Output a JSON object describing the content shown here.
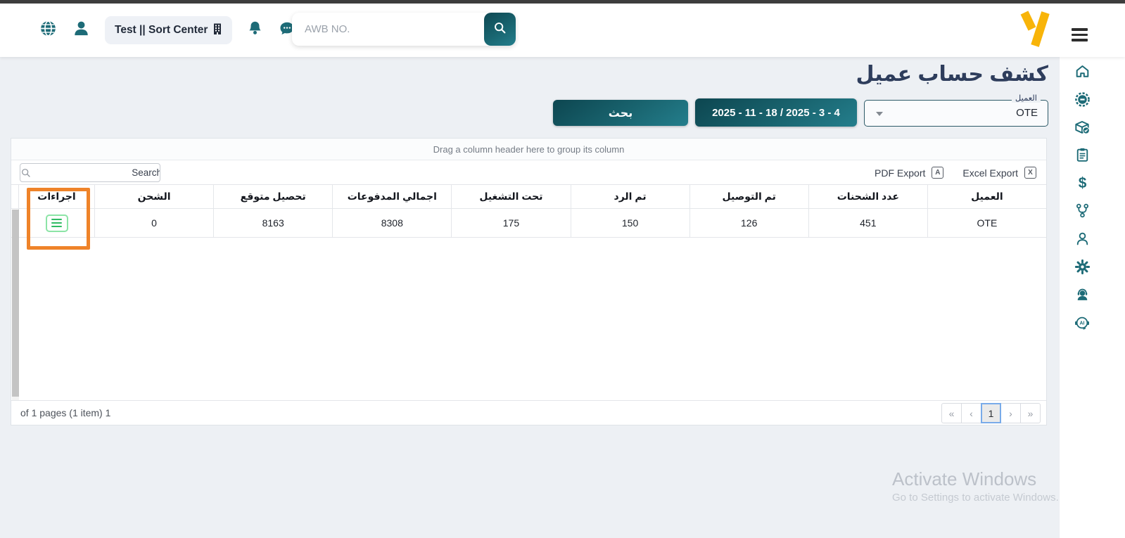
{
  "topbar": {
    "workspace": "Test || Sort Center",
    "awb_placeholder": "AWB NO."
  },
  "sidebar": {
    "items": [
      {
        "icon": "home-icon"
      },
      {
        "icon": "gear-badge-icon"
      },
      {
        "icon": "package-check-icon"
      },
      {
        "icon": "clipboard-icon"
      },
      {
        "icon": "dollar-icon"
      },
      {
        "icon": "branch-icon"
      },
      {
        "icon": "person-icon"
      },
      {
        "icon": "gear-icon"
      },
      {
        "icon": "support-agent-icon"
      },
      {
        "icon": "ai-assistant-icon"
      }
    ]
  },
  "page": {
    "title": "كشف حساب عميل",
    "client_field": {
      "label": "العميل",
      "value": "OTE"
    },
    "date_range": "2025 - 11 - 18 / 2025 - 3 - 4",
    "search_button": "بحث"
  },
  "grid": {
    "group_hint": "Drag a column header here to group its column",
    "search_placeholder": "Search",
    "pdf_export": "PDF Export",
    "excel_export": "Excel Export",
    "columns": [
      "العميل",
      "عدد الشحنات",
      "تم التوصيل",
      "تم الرد",
      "تحت التشغيل",
      "اجمالي المدفوعات",
      "تحصيل متوقع",
      "الشحن",
      "اجراءات"
    ],
    "row": {
      "client": "OTE",
      "shipments_count": "451",
      "delivered": "126",
      "returned": "150",
      "in_progress": "175",
      "total_payments": "8308",
      "expected_collection": "8163",
      "shipping": "0"
    },
    "pager_summary": "of 1 pages (1 item) 1",
    "pagination": {
      "first": "«",
      "prev": "‹",
      "page": "1",
      "next": "›",
      "last": "»"
    }
  },
  "icons": {
    "dollar": "$",
    "pdf": "A",
    "excel": "X",
    "ai": "AI"
  },
  "watermark": {
    "line1": "Activate Windows",
    "line2": "Go to Settings to activate Windows."
  },
  "colors": {
    "teal": "#1d6b77",
    "button_gradient_start": "#0d4650",
    "button_gradient_end": "#247e8c",
    "highlight_orange": "#ef8329",
    "brand_yellow": "#f8b409",
    "action_green": "#2fbb63",
    "title_navy": "#2e3d5c"
  }
}
